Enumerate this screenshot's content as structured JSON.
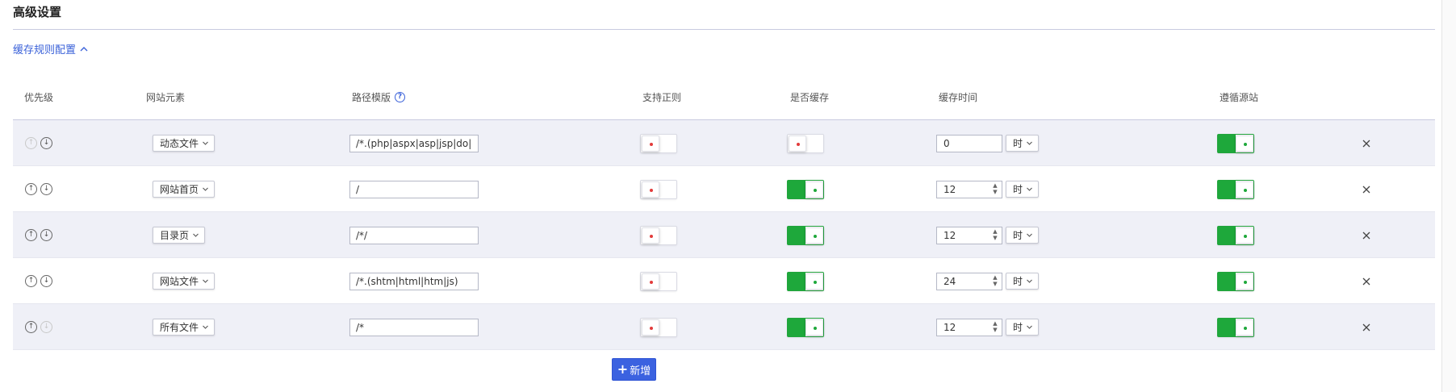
{
  "section": {
    "title": "高级设置",
    "collapse_link": "缓存规则配置"
  },
  "table": {
    "headers": {
      "priority": "优先级",
      "element": "网站元素",
      "path": "路径模版",
      "regex": "支持正则",
      "cache": "是否缓存",
      "cache_time": "缓存时间",
      "follow_origin": "遵循源站"
    },
    "rows": [
      {
        "up_enabled": false,
        "down_enabled": true,
        "element": "动态文件",
        "path": "/*.(php|aspx|asp|jsp|do|dwr",
        "regex": false,
        "cache": false,
        "time": "0",
        "show_spinner": false,
        "unit": "时",
        "follow": true
      },
      {
        "up_enabled": true,
        "down_enabled": true,
        "element": "网站首页",
        "path": "/",
        "regex": false,
        "cache": true,
        "time": "12",
        "show_spinner": true,
        "unit": "时",
        "follow": true
      },
      {
        "up_enabled": true,
        "down_enabled": true,
        "element": "目录页",
        "path": "/*/",
        "regex": false,
        "cache": true,
        "time": "12",
        "show_spinner": true,
        "unit": "时",
        "follow": true
      },
      {
        "up_enabled": true,
        "down_enabled": true,
        "element": "网站文件",
        "path": "/*.(shtm|html|htm|js)",
        "regex": false,
        "cache": true,
        "time": "24",
        "show_spinner": true,
        "unit": "时",
        "follow": true
      },
      {
        "up_enabled": true,
        "down_enabled": false,
        "element": "所有文件",
        "path": "/*",
        "regex": false,
        "cache": true,
        "time": "12",
        "show_spinner": true,
        "unit": "时",
        "follow": true
      }
    ]
  },
  "add_button": {
    "label": "新增"
  },
  "icons": {
    "help": "question-circle-icon",
    "up": "arrow-up-circle-icon",
    "down": "arrow-down-circle-icon",
    "caret": "chevron-down-icon",
    "delete": "close-icon"
  },
  "colors": {
    "accent": "#3b62d9",
    "switch_on": "#1ea83b",
    "switch_off_dot": "#e23b3b",
    "row_alt": "#eff0f7"
  }
}
